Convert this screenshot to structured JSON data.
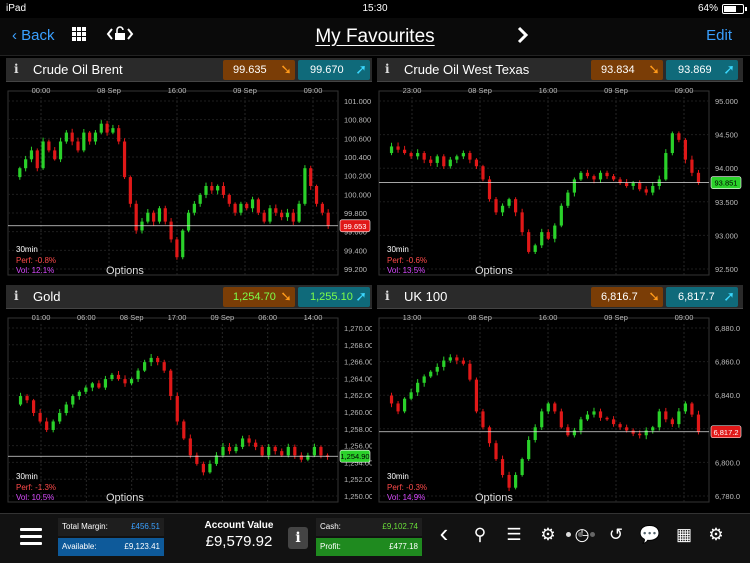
{
  "status": {
    "device": "iPad",
    "time": "15:30",
    "battery": "64%",
    "battery_level": 0.64
  },
  "nav": {
    "back": "Back",
    "title": "My Favourites",
    "edit": "Edit",
    "icons": [
      "grid-icon",
      "unlock-icon",
      "chevron-right-icon"
    ]
  },
  "colors": {
    "up": "#2ad12a",
    "down": "#e01818",
    "accent": "#3aa0ff",
    "sell_bg": "#7a3d06",
    "buy_bg": "#0f6a7a"
  },
  "panels": [
    {
      "name": "Crude Oil Brent",
      "sell": "99.635",
      "buy": "99.670",
      "timeframe": "30min",
      "perf": "Perf: -0.8%",
      "vol": "Vol: 12.1%",
      "options": "Options",
      "price_tag": "99.653",
      "price_tag_color": "#e01818",
      "time_labels": [
        "00:00",
        "08 Sep",
        "16:00",
        "09 Sep",
        "09:00"
      ],
      "y_labels": [
        "101.000",
        "100.800",
        "100.600",
        "100.400",
        "100.200",
        "100.000",
        "99.800",
        "99.600",
        "99.400",
        "99.200"
      ],
      "y_range": [
        99.1,
        101.1
      ],
      "current": 99.653,
      "path": [
        100.2,
        100.3,
        100.4,
        100.5,
        100.3,
        100.6,
        100.5,
        100.4,
        100.6,
        100.7,
        100.6,
        100.5,
        100.7,
        100.6,
        100.7,
        100.8,
        100.7,
        100.75,
        100.6,
        100.2,
        99.9,
        99.6,
        99.7,
        99.8,
        99.7,
        99.85,
        99.7,
        99.5,
        99.3,
        99.6,
        99.8,
        99.9,
        100.0,
        100.1,
        100.05,
        100.1,
        100.0,
        99.9,
        99.8,
        99.9,
        99.85,
        99.95,
        99.8,
        99.7,
        99.85,
        99.8,
        99.75,
        99.8,
        99.7,
        99.9,
        100.3,
        100.1,
        99.9,
        99.8,
        99.65
      ]
    },
    {
      "name": "Crude Oil West Texas",
      "sell": "93.834",
      "buy": "93.869",
      "timeframe": "30min",
      "perf": "Perf: -0.6%",
      "vol": "Vol: 13.5%",
      "options": "Options",
      "price_tag": "93.851",
      "price_tag_color": "#2ad12a",
      "time_labels": [
        "23:00",
        "08 Sep",
        "16:00",
        "09 Sep",
        "09:00"
      ],
      "y_labels": [
        "95.000",
        "94.500",
        "94.000",
        "93.500",
        "93.000",
        "92.500"
      ],
      "y_range": [
        92.45,
        95.15
      ],
      "current": 93.851,
      "path": [
        94.3,
        94.4,
        94.35,
        94.3,
        94.25,
        94.3,
        94.2,
        94.15,
        94.25,
        94.1,
        94.2,
        94.25,
        94.3,
        94.2,
        94.1,
        93.9,
        93.6,
        93.4,
        93.5,
        93.6,
        93.4,
        93.1,
        92.8,
        92.9,
        93.1,
        93.0,
        93.2,
        93.5,
        93.7,
        93.9,
        94.0,
        93.95,
        93.9,
        94.0,
        93.95,
        93.9,
        93.85,
        93.8,
        93.85,
        93.75,
        93.7,
        93.8,
        93.9,
        94.3,
        94.6,
        94.5,
        94.2,
        94.0,
        93.85
      ]
    },
    {
      "name": "Gold",
      "sell": "1,254.70",
      "buy": "1,255.10",
      "timeframe": "30min",
      "perf": "Perf: -1.3%",
      "vol": "Vol: 10.5%",
      "options": "Options",
      "price_tag": "1,254.90",
      "price_tag_color": "#2ad12a",
      "time_labels": [
        "01:00",
        "06:00",
        "08 Sep",
        "17:00",
        "09 Sep",
        "06:00",
        "14:00"
      ],
      "y_labels": [
        "1,270.00",
        "1,268.00",
        "1,266.00",
        "1,264.00",
        "1,262.00",
        "1,260.00",
        "1,258.00",
        "1,256.00",
        "1,254.00",
        "1,252.00",
        "1,250.00"
      ],
      "y_range": [
        1249.5,
        1270.5
      ],
      "current": 1254.9,
      "path": [
        1261,
        1262,
        1261.5,
        1260,
        1259,
        1258,
        1259,
        1260,
        1261,
        1262,
        1262.5,
        1263,
        1263.5,
        1263,
        1264,
        1264.5,
        1264,
        1263.5,
        1264,
        1265,
        1266,
        1266.5,
        1266,
        1265,
        1262,
        1259,
        1257,
        1255,
        1254,
        1253,
        1254,
        1255,
        1256,
        1255.5,
        1256,
        1257,
        1256.5,
        1256,
        1255,
        1256,
        1255.5,
        1255,
        1256,
        1255,
        1254.5,
        1255,
        1256,
        1255,
        1254.9
      ]
    },
    {
      "name": "UK 100",
      "sell": "6,816.7",
      "buy": "6,817.7",
      "timeframe": "30min",
      "perf": "Perf: -0.3%",
      "vol": "Vol: 14.9%",
      "options": "Options",
      "price_tag": "6,817.2",
      "price_tag_color": "#e01818",
      "time_labels": [
        "13:00",
        "08 Sep",
        "16:00",
        "09 Sep",
        "09:00"
      ],
      "y_labels": [
        "6,880.0",
        "6,860.0",
        "6,840.0",
        "6,820.0",
        "6,800.0",
        "6,780.0"
      ],
      "y_range": [
        6773,
        6885
      ],
      "current": 6817.2,
      "path": [
        6840,
        6835,
        6830,
        6838,
        6842,
        6848,
        6852,
        6855,
        6858,
        6862,
        6864,
        6862,
        6860,
        6850,
        6830,
        6820,
        6810,
        6800,
        6790,
        6782,
        6790,
        6800,
        6812,
        6820,
        6830,
        6835,
        6830,
        6820,
        6815,
        6818,
        6825,
        6828,
        6830,
        6826,
        6825,
        6822,
        6820,
        6818,
        6816,
        6815,
        6818,
        6820,
        6830,
        6825,
        6822,
        6830,
        6835,
        6828,
        6817
      ]
    }
  ],
  "account": {
    "total_margin_label": "Total Margin:",
    "total_margin": "£456.51",
    "available_label": "Available:",
    "available": "£9,123.41",
    "account_value_label": "Account Value",
    "account_value": "£9,579.92",
    "cash_label": "Cash:",
    "cash": "£9,102.74",
    "profit_label": "Profit:",
    "profit": "£477.18"
  },
  "toolbar_icons": [
    "chevron-left-icon",
    "search-icon",
    "list-icon",
    "settings-icon",
    "clock-icon",
    "history-icon",
    "chat-icon",
    "calendar-icon",
    "gear-icon"
  ]
}
